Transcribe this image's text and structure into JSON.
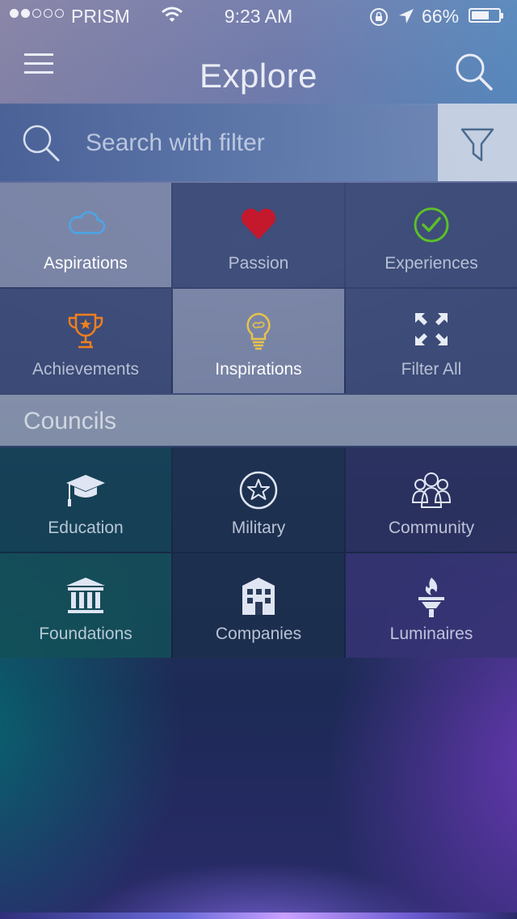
{
  "status_bar": {
    "carrier": "PRISM",
    "signal_bars_filled": 2,
    "signal_bars_total": 5,
    "time": "9:23 AM",
    "battery_percent": "66%",
    "battery_level": 0.66
  },
  "nav": {
    "title": "Explore",
    "menu_icon": "hamburger-menu-icon",
    "search_icon": "search-icon"
  },
  "search": {
    "placeholder": "Search with filter",
    "value": "",
    "filter_icon": "funnel-icon"
  },
  "categories": [
    {
      "label": "Aspirations",
      "icon": "cloud-icon",
      "color": "#4aa6e8",
      "selected": true
    },
    {
      "label": "Passion",
      "icon": "heart-icon",
      "color": "#c4182c",
      "selected": false
    },
    {
      "label": "Experiences",
      "icon": "check-circle-icon",
      "color": "#5cbf2a",
      "selected": false
    },
    {
      "label": "Achievements",
      "icon": "trophy-icon",
      "color": "#f07f1e",
      "selected": false
    },
    {
      "label": "Inspirations",
      "icon": "lightbulb-icon",
      "color": "#e8c24a",
      "selected": true
    },
    {
      "label": "Filter All",
      "icon": "expand-arrows-icon",
      "color": "#e6ebf5",
      "selected": false
    }
  ],
  "councils": {
    "header": "Councils",
    "items": [
      {
        "label": "Education",
        "icon": "graduation-cap-icon"
      },
      {
        "label": "Military",
        "icon": "star-circle-icon"
      },
      {
        "label": "Community",
        "icon": "people-group-icon"
      },
      {
        "label": "Foundations",
        "icon": "columns-building-icon"
      },
      {
        "label": "Companies",
        "icon": "office-building-icon"
      },
      {
        "label": "Luminaires",
        "icon": "torch-icon"
      }
    ]
  }
}
